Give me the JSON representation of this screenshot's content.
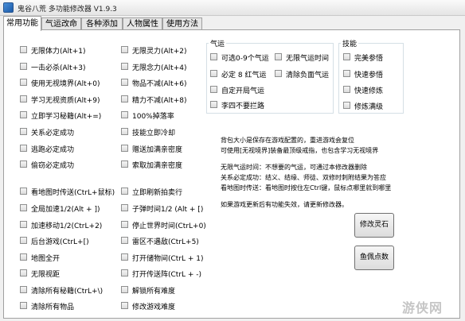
{
  "window": {
    "title": "鬼谷八荒 多功能修改器  V1.9.3"
  },
  "tabs": [
    "常用功能",
    "气运改命",
    "各种添加",
    "人物属性",
    "使用方法"
  ],
  "col1": [
    "无限体力(Alt+1)",
    "一击必杀(Alt+3)",
    "使用无视境界(Alt+0)",
    "学习无视资质(Alt+9)",
    "立即学习秘籍(Alt+=)",
    "关系必定成功",
    "逃跑必定成功",
    "偷窃必定成功"
  ],
  "col2": [
    "无限灵力(Alt+2)",
    "无限念力(Alt+4)",
    "物品不减(Alt+6)",
    "精力不减(Alt+8)",
    "100%掉落率",
    "技能立即冷却",
    "赠送加满亲密度",
    "索取加满亲密度"
  ],
  "col3": [
    "看地图时传送(CtrL+鼠标)",
    "全局加速1/2(Alt + ])",
    "加速移动1/2(CtrL+2)",
    "后台游戏(CtrL+[)",
    "地图全开",
    "无限视距",
    "清除所有秘籍(CtrL+\\)",
    "清除所有物品"
  ],
  "col4": [
    "立即刷新拍卖行",
    "子弹时间1/2 (Alt + [)",
    "停止世界时间(CtrL+0)",
    "雷区不遇敌(CtrL+5)",
    "打开储物间(CtrL + 1)",
    "打开传送阵(CtrL + -)",
    "解锁所有难度",
    "修改游戏难度"
  ],
  "fortune": {
    "title": "气运",
    "items": [
      "可选0-9个气运",
      "无限气运时间",
      "必定 8 红气运",
      "清除负面气运",
      "自定开局气运",
      "李四不要拦路"
    ]
  },
  "skill": {
    "title": "技能",
    "items": [
      "完美参悟",
      "快速参悟",
      "快速修炼",
      "修炼满级"
    ]
  },
  "info": [
    "背包大小是保存在游戏配置的，重进游戏会复位",
    "可使用[无视境界]装备最顶级戒指，也包含学习无视境界",
    "无限气运时间：不想要的气运，可通过本修改器删除",
    "关系必定成功：结义、结缘、师徒、双修时刺附结果为答应",
    "看地图时传送：看地图时按住左Ctrl键，鼠标点哪里就到哪里",
    "如果游戏更新后有功能失效，请更新修改器。"
  ],
  "buttons": {
    "modify_stone": "修改灵石",
    "fish_points": "鱼佩点数"
  },
  "watermark": "游侠网"
}
